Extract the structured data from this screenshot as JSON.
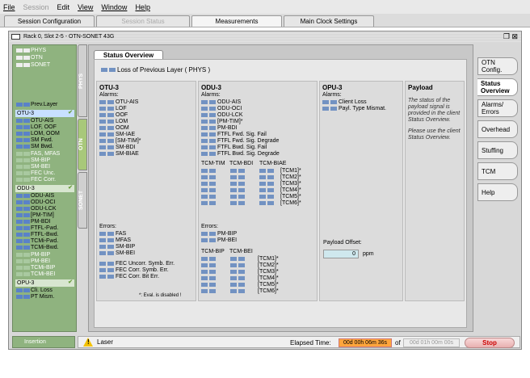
{
  "menu": [
    "File",
    "Session",
    "Edit",
    "View",
    "Window",
    "Help"
  ],
  "tabs": [
    "Session Configuration",
    "Session Status",
    "Measurements",
    "Main Clock Settings"
  ],
  "window": {
    "title": "Rack 0, Slot 2-5 - OTN-SONET 43G"
  },
  "left_top": [
    "PHYS",
    "OTN",
    "SONET"
  ],
  "vtabs": [
    "PHYS",
    "OTN",
    "SONET"
  ],
  "left": {
    "prev_layer": "Prev.Layer",
    "otu_title": "OTU-3",
    "otu_items": [
      "OTU-AIS",
      "LOF, OOF",
      "LOM, OOM",
      "SM Fwd.",
      "SM Bwd."
    ],
    "otu_items_dim": [
      "FAS, MFAS",
      "SM-BIP",
      "SM-BEI",
      "FEC Unc.",
      "FEC Corr."
    ],
    "odu_title": "ODU-3",
    "odu_items": [
      "ODU-AIS",
      "ODU-OCI",
      "ODU-LCK",
      "[PM-TIM]",
      "PM-BDI",
      "FTFL-Fwd.",
      "FTFL-Bwd.",
      "TCMi-Fwd.",
      "TCMi-Bwd."
    ],
    "odu_items_dim": [
      "PM-BIP",
      "PM-BEI",
      "TCMi-BIP",
      "TCMi-BEI"
    ],
    "opu_title": "OPU-3",
    "opu_items": [
      "Cli. Loss",
      "PT Mism."
    ],
    "insertion": "Insertion"
  },
  "status": {
    "tab": "Status Overview",
    "lpl": "Loss of Previous Layer  ( PHYS )",
    "otu": {
      "title": "OTU-3",
      "alarms": "Alarms:",
      "alarm_items": [
        "OTU-AIS",
        "LOF",
        "OOF",
        "LOM",
        "OOM",
        "SM-IAE",
        "[SM-TIM]*",
        "SM-BDI",
        "SM-BIAE"
      ],
      "errors": "Errors:",
      "error_items": [
        "FAS",
        "MFAS",
        "SM-BIP",
        "SM-BEI"
      ],
      "fec_items": [
        "FEC Uncorr. Symb. Err.",
        "FEC Corr. Symb. Err.",
        "FEC Corr. Bit Err."
      ],
      "footnote": "*: Eval. is disabled !"
    },
    "odu": {
      "title": "ODU-3",
      "alarms": "Alarms:",
      "alarm_items": [
        "ODU-AIS",
        "ODU-OCI",
        "ODU-LCK",
        "[PM-TIM]*",
        "PM-BDI",
        "FTFL Fwd. Sig. Fail",
        "FTFL Fwd. Sig. Degrade",
        "FTFL Bwd. Sig. Fail",
        "FTFL Bwd. Sig. Degrade"
      ],
      "tcm_headers": [
        "TCM-TIM",
        "TCM-BDI",
        "TCM-BIAE"
      ],
      "tcm_rows": [
        "[TCM1]*",
        "[TCM2]*",
        "[TCM3]*",
        "[TCM4]*",
        "[TCM5]*",
        "[TCM6]*"
      ],
      "errors": "Errors:",
      "error_items": [
        "PM-BIP",
        "PM-BEI"
      ],
      "tcm_err_headers": [
        "TCM-BIP",
        "TCM-BEI"
      ],
      "tcm_err_rows": [
        "[TCM1]*",
        "[TCM2]*",
        "[TCM3]*",
        "[TCM4]*",
        "[TCM5]*",
        "[TCM6]*"
      ]
    },
    "opu": {
      "title": "OPU-3",
      "alarms": "Alarms:",
      "alarm_items": [
        "Client Loss",
        "Payl. Type Mismat."
      ],
      "offset_label": "Payload Offset:",
      "offset_value": "0",
      "offset_unit": "ppm"
    },
    "payload": {
      "title": "Payload",
      "note1": "The status of the payload signal is provided in the client Status Overview.",
      "note2": "Please use the client Status Overview."
    }
  },
  "right_tabs": [
    "OTN Config.",
    "Status Overview",
    "Alarms/ Errors",
    "Overhead",
    "Stuffing",
    "TCM",
    "Help"
  ],
  "statusbar": {
    "laser": "Laser",
    "elapsed_label": "Elapsed Time:",
    "elapsed": "00d 00h 06m 36s",
    "of": "of",
    "total": "00d 01h 00m 00s",
    "stop": "Stop"
  }
}
